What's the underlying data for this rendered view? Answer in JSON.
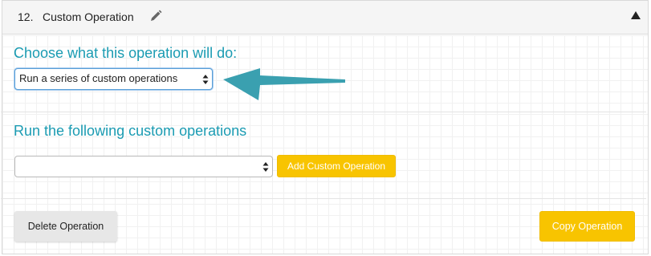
{
  "header": {
    "number": "12.",
    "title": "Custom Operation",
    "edit_icon": "pencil-icon",
    "collapse_icon": "triangle-up-icon"
  },
  "choose": {
    "heading": "Choose what this operation will do:",
    "selected": "Run a series of custom operations"
  },
  "custom_ops": {
    "heading": "Run the following custom operations",
    "selected": "",
    "add_label": "Add Custom Operation"
  },
  "footer": {
    "delete_label": "Delete Operation",
    "copy_label": "Copy Operation"
  },
  "colors": {
    "accent_teal": "#1a9bb2",
    "button_yellow": "#f8c400",
    "arrow_teal": "#3aa0b0"
  }
}
